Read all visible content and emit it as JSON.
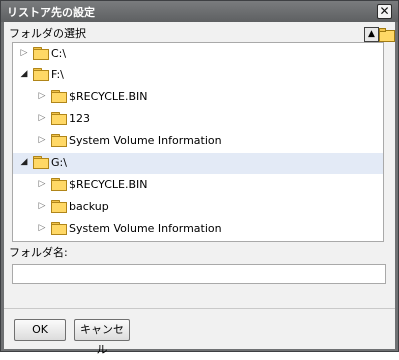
{
  "window": {
    "title": "リストア先の設定",
    "close_glyph": "✕"
  },
  "folder_select": {
    "label": "フォルダの選択",
    "up_icon": "arrow-up-icon",
    "new_folder_icon": "new-folder-icon"
  },
  "tree": {
    "items": [
      {
        "label": "C:\\",
        "expanded": false
      },
      {
        "label": "F:\\",
        "expanded": true
      },
      {
        "label": "$RECYCLE.BIN",
        "expanded": false
      },
      {
        "label": "123",
        "expanded": false
      },
      {
        "label": "System Volume Information",
        "expanded": false
      },
      {
        "label": "G:\\",
        "expanded": true,
        "selected": true
      },
      {
        "label": "$RECYCLE.BIN",
        "expanded": false
      },
      {
        "label": "backup",
        "expanded": false
      },
      {
        "label": "System Volume Information",
        "expanded": false
      }
    ]
  },
  "folder_name": {
    "label": "フォルダ名:",
    "value": "",
    "placeholder": ""
  },
  "buttons": {
    "ok": "OK",
    "cancel": "キャンセル"
  },
  "colors": {
    "titlebar": "#6f7173",
    "selection": "#e3eaf6",
    "folder": "#ffd866"
  }
}
